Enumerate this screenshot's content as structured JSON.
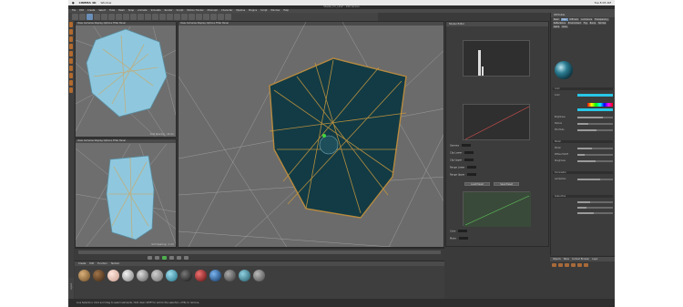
{
  "macbar": {
    "app_name": "CINEMA 4D",
    "menus": [
      "Window"
    ],
    "clock": "Tue 8:03 AM"
  },
  "window": {
    "title": "Shader_For_Lillie* - R16 Version"
  },
  "app_menu": [
    "File",
    "Edit",
    "Create",
    "Select",
    "Tools",
    "Mesh",
    "Snap",
    "Animate",
    "Simulate",
    "Render",
    "Sculpt",
    "Motion Tracker",
    "MoGraph",
    "Character",
    "Pipeline",
    "Plugins",
    "Script",
    "Window",
    "Help"
  ],
  "viewports": {
    "top": {
      "head": "View  Cameras  Display  Options  Filter  Panel",
      "name": "Top",
      "foot": "Grid Spacing : 10 cm"
    },
    "front": {
      "head": "View  Cameras  Display  Options  Filter  Panel",
      "name": "Front",
      "foot": "Grid Spacing : 1 cm"
    },
    "perspective": {
      "head": "View  Cameras  Display  Options  Filter  Panel",
      "name": "Perspective"
    }
  },
  "material_bar": {
    "tabs": [
      "Create",
      "Edit",
      "Function",
      "Texture"
    ]
  },
  "shader": {
    "title": "Shader Editor",
    "labels": [
      "Input",
      "Output",
      "Gamma",
      "Clip Lower",
      "Clip Upper",
      "Range Lower",
      "Range Upper",
      "Invert",
      "Custom Range",
      "Color",
      "Mode"
    ],
    "values": {
      "gamma": "1",
      "lower": "0",
      "upper": "1",
      "range_lower": "0",
      "range_upper": "1"
    },
    "buttons": [
      "Load Preset",
      "Save Preset",
      "Update"
    ]
  },
  "attributes": {
    "title": "Attributes",
    "tabs": [
      "Basic",
      "Color",
      "Diffusion",
      "Luminance",
      "Transparency",
      "Reflectance",
      "Environment",
      "Fog",
      "Bump",
      "Normal",
      "Alpha",
      "Glow",
      "Displacement",
      "Editor",
      "Illumination",
      "Assign"
    ],
    "sections": [
      "Color",
      "Texture",
      "Brightness",
      "Mix Mode",
      "Model",
      "Diffuse Falloff",
      "Diffuse Level",
      "Roughness",
      "Illumination",
      "Subsurface"
    ],
    "fields": [
      "Color",
      "Brightness",
      "Texture",
      "Mix Mode",
      "Mix Strength",
      "Model",
      "Diffuse Falloff",
      "Roughness",
      "Lambertian"
    ],
    "brightness": 0.72
  },
  "object_manager": {
    "tabs": [
      "Objects",
      "Takes",
      "Content Browser",
      "Layer"
    ]
  },
  "status": {
    "text": "Live Selection: Click and drag to select elements. Hold down SHIFT to add to the selection, CTRL to remove."
  },
  "side_label": "Layout",
  "colors": {
    "accent": "#6a8fb8",
    "orange": "#b06a2f",
    "cyan": "#28c6e6",
    "viewport": "#6e6e6e"
  },
  "icons": [
    "apple-icon",
    "undo-icon",
    "move-icon",
    "scale-icon",
    "rotate-icon",
    "render-icon",
    "cube-icon",
    "play-icon"
  ]
}
